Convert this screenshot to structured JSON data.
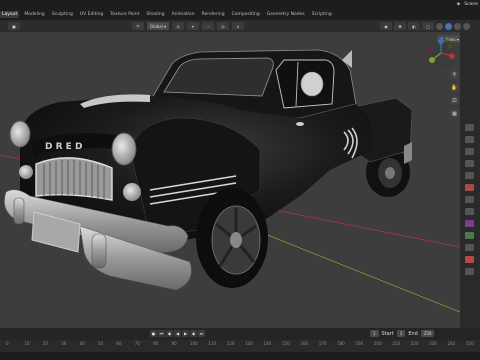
{
  "topbar": {
    "tabs": [
      "Layout",
      "Modeling",
      "Sculpting",
      "UV Editing",
      "Texture Paint",
      "Shading",
      "Animation",
      "Rendering",
      "Compositing",
      "Geometry Nodes",
      "Scripting"
    ],
    "active_tab": "Layout",
    "scene_label": "Scene"
  },
  "viewport_header": {
    "orientation": "Global",
    "options_label": "Options"
  },
  "car": {
    "grille_lettering": "D R E D"
  },
  "timeline": {
    "current_frame": "1",
    "start_label": "Start",
    "start_value": "1",
    "end_label": "End",
    "end_value": "250",
    "ticks": [
      "0",
      "10",
      "20",
      "30",
      "40",
      "50",
      "60",
      "70",
      "80",
      "90",
      "100",
      "110",
      "120",
      "130",
      "140",
      "150",
      "160",
      "170",
      "180",
      "190",
      "200",
      "210",
      "220",
      "230",
      "240",
      "250"
    ]
  },
  "colors": {
    "accent": "#4772b3",
    "viewport_bg": "#3d3d3d",
    "x_axis": "#b3333f",
    "y_axis": "#7fa23a"
  }
}
